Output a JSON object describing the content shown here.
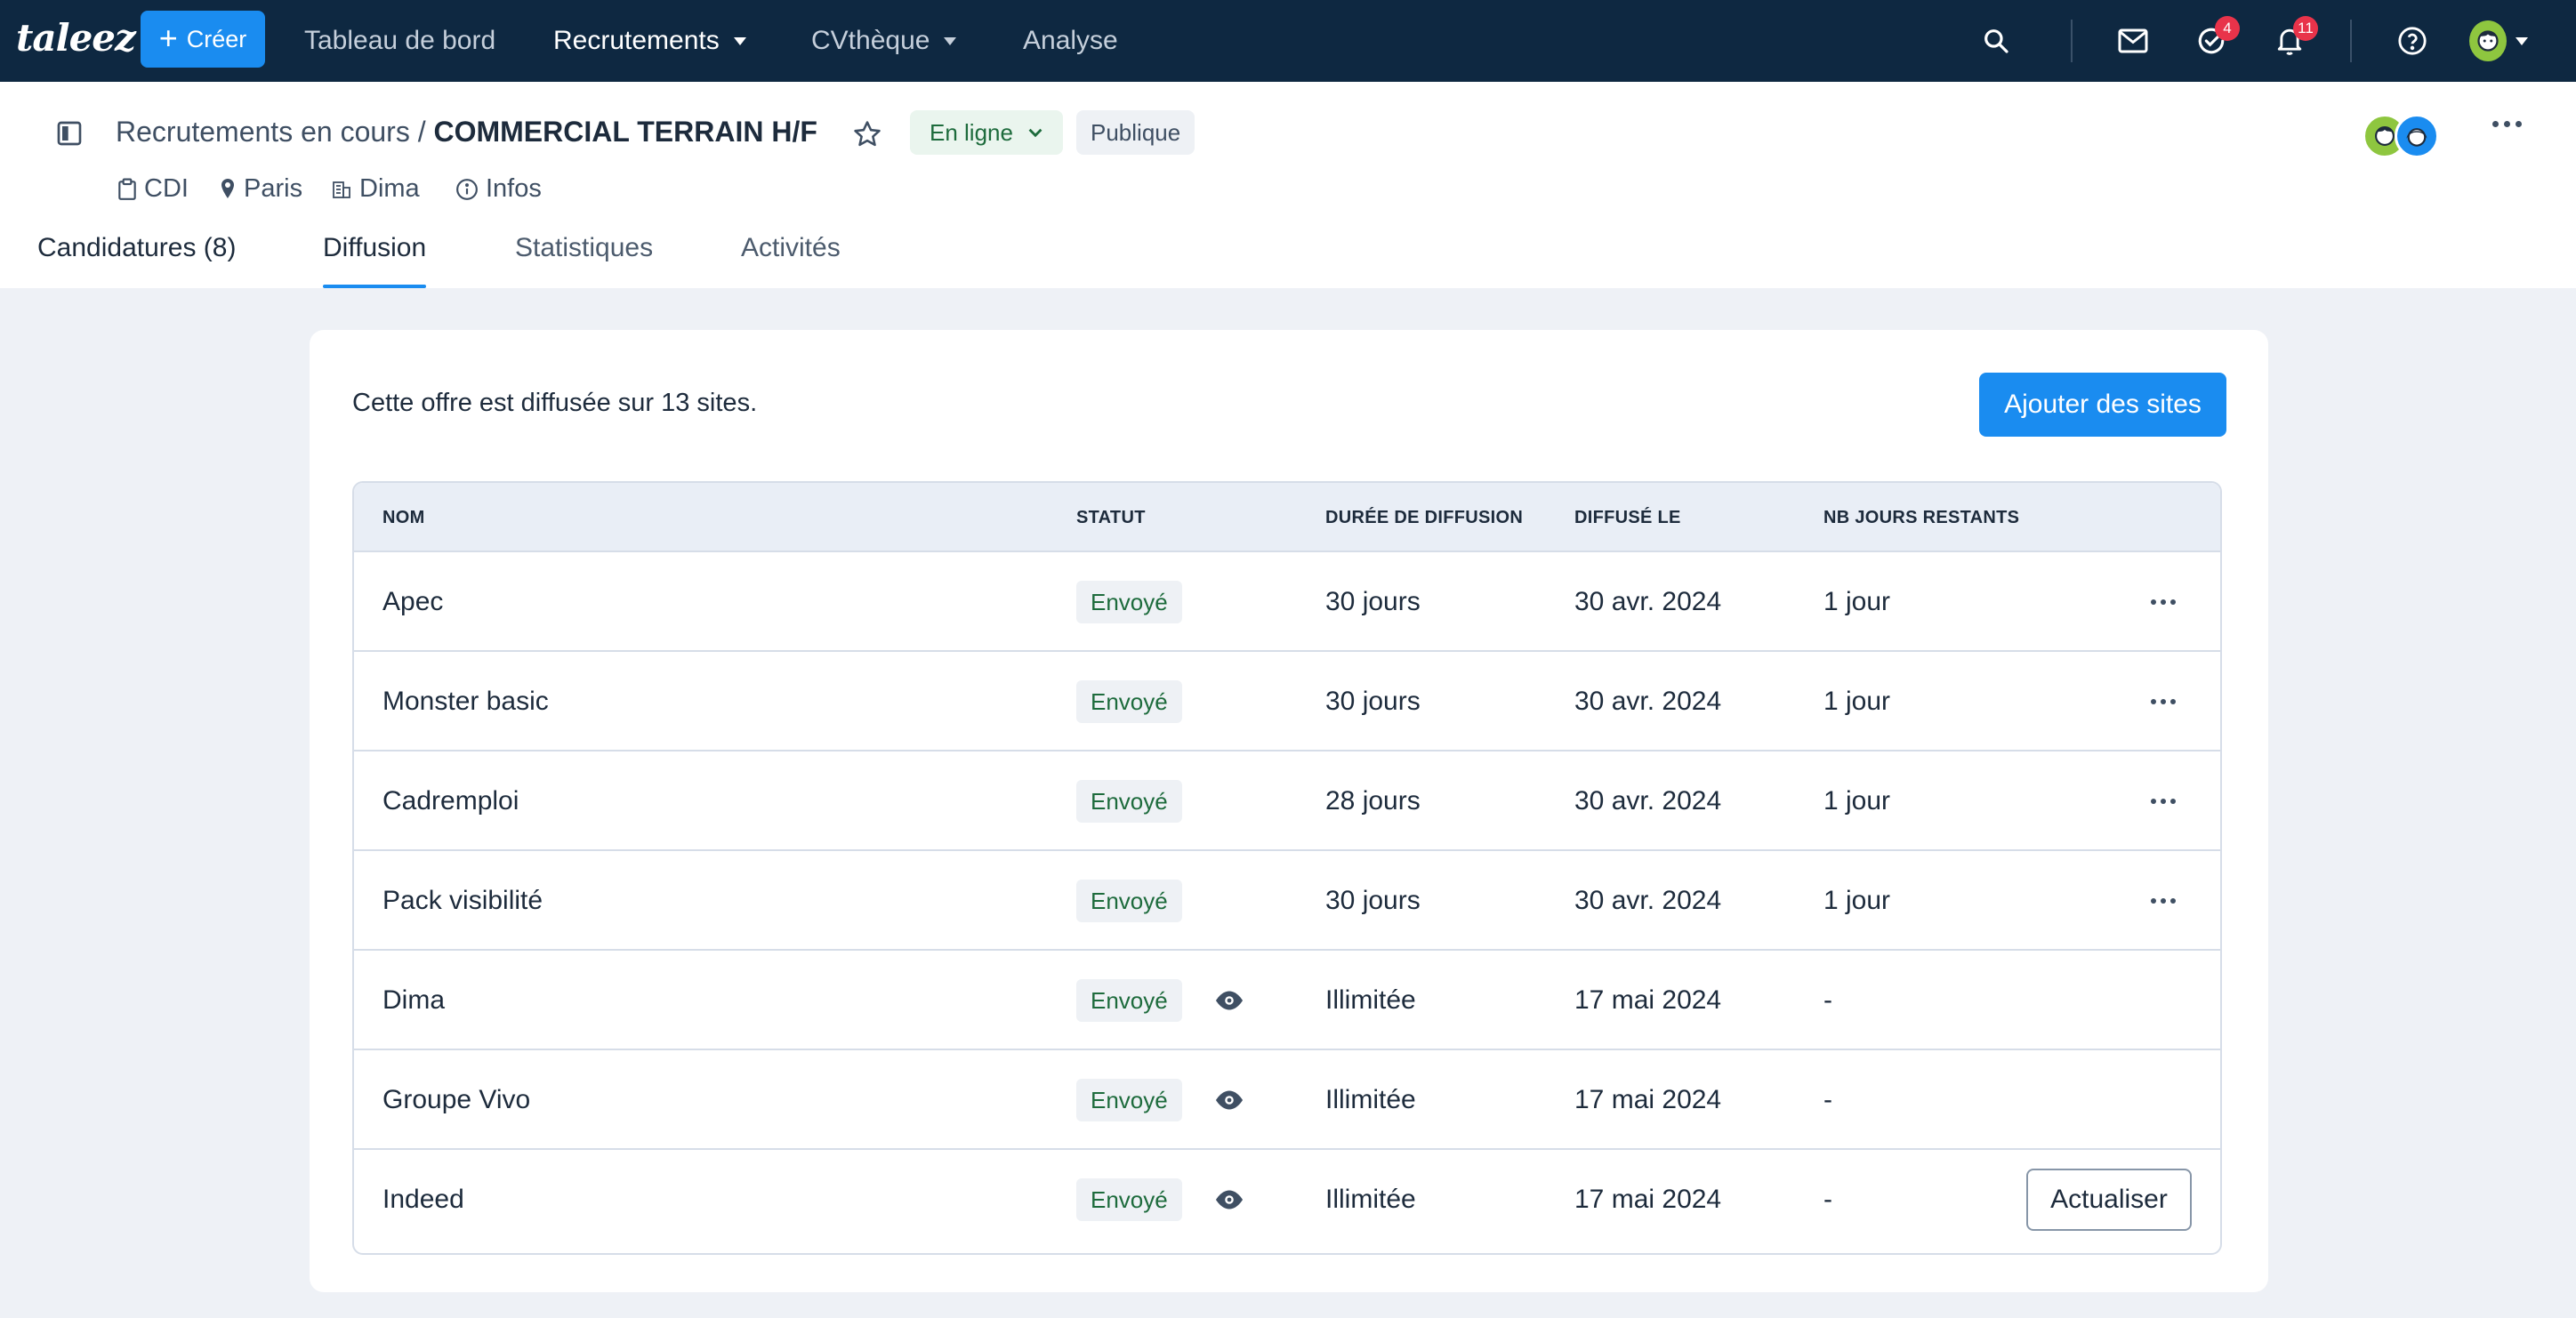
{
  "app": {
    "logo": "taleez",
    "create_label": "Créer",
    "nav": {
      "dashboard": "Tableau de bord",
      "recruitments": "Recrutements",
      "cvtheque": "CVthèque",
      "analysis": "Analyse"
    },
    "badges": {
      "tasks": "4",
      "notifications": "11"
    }
  },
  "header": {
    "breadcrumb_parent": "Recrutements en cours /",
    "job_title": "COMMERCIAL TERRAIN H/F",
    "status": "En ligne",
    "visibility": "Publique",
    "meta": {
      "contract": "CDI",
      "location": "Paris",
      "company": "Dima",
      "info": "Infos"
    },
    "tabs": {
      "applications": "Candidatures (8)",
      "diffusion": "Diffusion",
      "statistics": "Statistiques",
      "activities": "Activités"
    }
  },
  "diffusion": {
    "summary": "Cette offre est diffusée sur 13 sites.",
    "add_button": "Ajouter des sites",
    "columns": {
      "name": "NOM",
      "status": "STATUT",
      "duration": "DURÉE DE DIFFUSION",
      "date": "DIFFUSÉ LE",
      "remaining": "NB JOURS RESTANTS"
    },
    "rows": [
      {
        "name": "Apec",
        "status": "Envoyé",
        "duration": "30 jours",
        "date": "30 avr. 2024",
        "remaining": "1 jour"
      },
      {
        "name": "Monster basic",
        "status": "Envoyé",
        "duration": "30 jours",
        "date": "30 avr. 2024",
        "remaining": "1 jour"
      },
      {
        "name": "Cadremploi",
        "status": "Envoyé",
        "duration": "28 jours",
        "date": "30 avr. 2024",
        "remaining": "1 jour"
      },
      {
        "name": "Pack visibilité",
        "status": "Envoyé",
        "duration": "30 jours",
        "date": "30 avr. 2024",
        "remaining": "1 jour"
      },
      {
        "name": "Dima",
        "status": "Envoyé",
        "duration": "Illimitée",
        "date": "17 mai 2024",
        "remaining": "-"
      },
      {
        "name": "Groupe Vivo",
        "status": "Envoyé",
        "duration": "Illimitée",
        "date": "17 mai 2024",
        "remaining": "-"
      },
      {
        "name": "Indeed",
        "status": "Envoyé",
        "duration": "Illimitée",
        "date": "17 mai 2024",
        "remaining": "-"
      }
    ],
    "refresh_button": "Actualiser"
  },
  "colors": {
    "navbar": "#0e2841",
    "accent": "#1a8cf0",
    "badge": "#e8334a",
    "status_green": "#1d6b3c"
  }
}
